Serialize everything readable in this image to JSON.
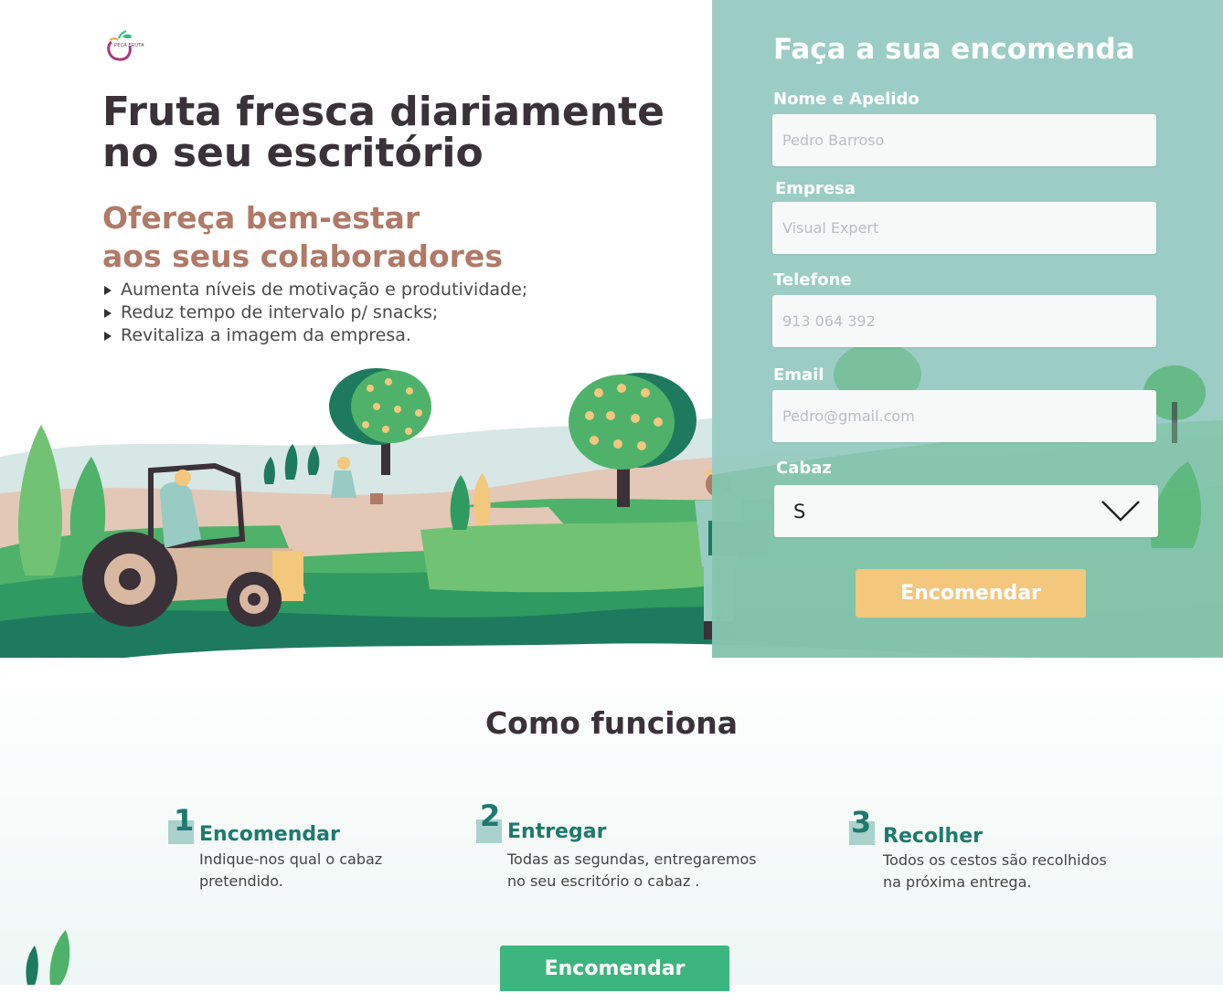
{
  "brand": {
    "logo_text": "PEÇA FRUTA"
  },
  "hero": {
    "title_line1": "Fruta fresca diariamente",
    "title_line2": "no seu escritório",
    "subtitle_line1": "Ofereça bem-estar",
    "subtitle_line2": "aos seus colaboradores",
    "bullets": [
      "Aumenta níveis de motivação e produtividade;",
      "Reduz tempo de intervalo p/ snacks;",
      "Revitaliza a imagem da empresa."
    ]
  },
  "order_form": {
    "title": "Faça a sua encomenda",
    "name_label": "Nome e Apelido",
    "name_placeholder": "Pedro Barroso",
    "company_label": "Empresa",
    "company_placeholder": "Visual Expert",
    "phone_label": "Telefone",
    "phone_placeholder": "913 064 392",
    "email_label": "Email",
    "email_placeholder": "Pedro@gmail.com",
    "basket_label": "Cabaz",
    "basket_value": "S",
    "submit_label": "Encomendar"
  },
  "how_it_works": {
    "title": "Como funciona",
    "steps": [
      {
        "number": "1",
        "title": "Encomendar",
        "desc_line1": "Indique-nos qual o cabaz",
        "desc_line2": "pretendido."
      },
      {
        "number": "2",
        "title": "Entregar",
        "desc_line1": "Todas as segundas, entregaremos",
        "desc_line2": "no seu escritório o cabaz ."
      },
      {
        "number": "3",
        "title": "Recolher",
        "desc_line1": "Todos os cestos são recolhidos",
        "desc_line2": "na próxima entrega."
      }
    ]
  },
  "cta_bottom": {
    "label": "Encomendar"
  },
  "colors": {
    "panel": "#98cbc4",
    "accent_green": "#3db57f",
    "accent_yellow": "#f3c77c",
    "heading_dark": "#3a3238",
    "subtitle_brown": "#b07a67",
    "step_teal": "#1e7a6e"
  }
}
